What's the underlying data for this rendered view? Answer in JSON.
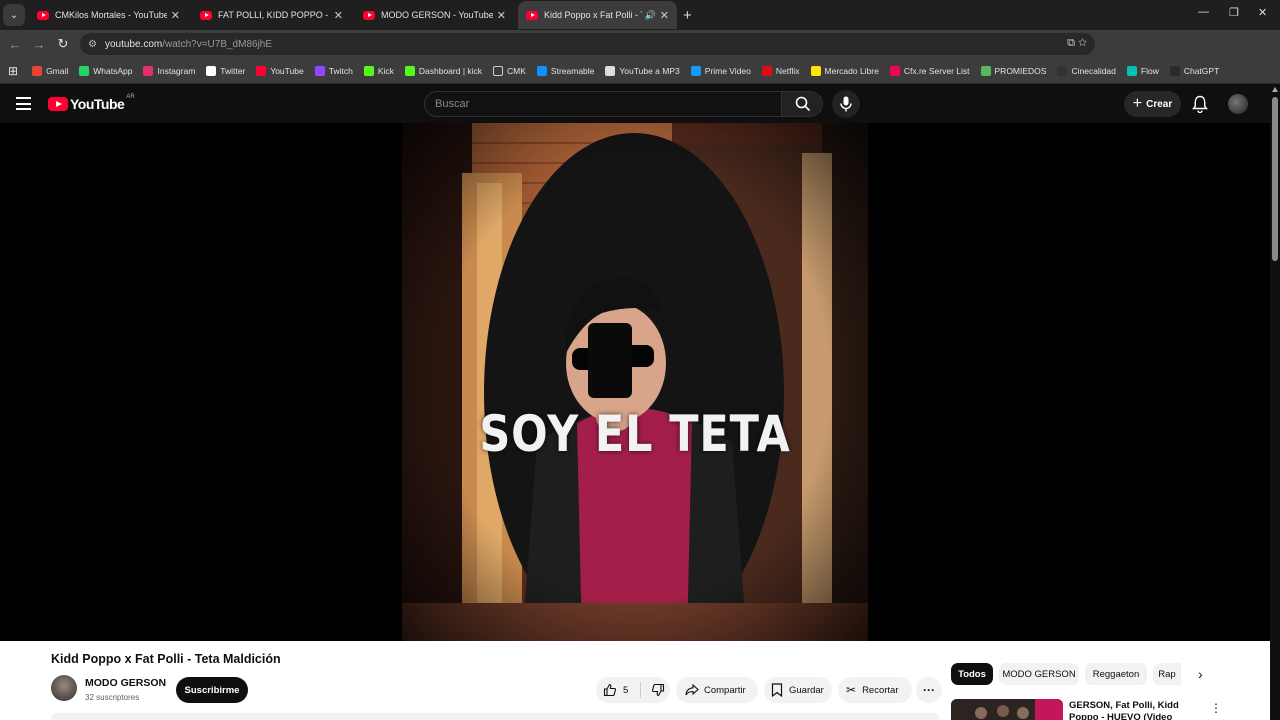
{
  "browser": {
    "tabs": [
      {
        "title": "CMKilos Mortales - YouTube",
        "active": false
      },
      {
        "title": "FAT POLLI, KIDD POPPO - PEPI",
        "active": false
      },
      {
        "title": "MODO GERSON - YouTube",
        "active": false
      },
      {
        "title": "Kidd Poppo x Fat Polli - Teta",
        "active": true,
        "audio": true
      }
    ],
    "url_host": "youtube.com",
    "url_path": "/watch?v=U7B_dM86jhE",
    "bookmarks": [
      {
        "label": "Gmail",
        "icon": "gmail-icon",
        "color": "#ea4335"
      },
      {
        "label": "WhatsApp",
        "icon": "whatsapp-icon",
        "color": "#25d366"
      },
      {
        "label": "Instagram",
        "icon": "instagram-icon",
        "color": "#e1306c"
      },
      {
        "label": "Twitter",
        "icon": "x-icon",
        "color": "#ffffff"
      },
      {
        "label": "YouTube",
        "icon": "youtube-icon",
        "color": "#ff0033"
      },
      {
        "label": "Twitch",
        "icon": "twitch-icon",
        "color": "#9146ff"
      },
      {
        "label": "Kick",
        "icon": "kick-icon",
        "color": "#53fc18"
      },
      {
        "label": "Dashboard | kick",
        "icon": "kick-icon",
        "color": "#53fc18"
      },
      {
        "label": "CMK",
        "icon": "folder-icon",
        "color": "#3c3c3c"
      },
      {
        "label": "Streamable",
        "icon": "streamable-icon",
        "color": "#0f90fa"
      },
      {
        "label": "YouTube a MP3",
        "icon": "mp3-icon",
        "color": "#dddddd"
      },
      {
        "label": "Prime Video",
        "icon": "prime-video-icon",
        "color": "#1399ff"
      },
      {
        "label": "Netflix",
        "icon": "netflix-icon",
        "color": "#e50914"
      },
      {
        "label": "Mercado Libre",
        "icon": "mercadolibre-icon",
        "color": "#ffe600"
      },
      {
        "label": "Cfx.re Server List",
        "icon": "cfx-icon",
        "color": "#f40552"
      },
      {
        "label": "PROMIEDOS",
        "icon": "promiedos-icon",
        "color": "#5cb85c"
      },
      {
        "label": "Cinecalidad",
        "icon": "cinecalidad-icon",
        "color": "#333333"
      },
      {
        "label": "Flow",
        "icon": "flow-icon",
        "color": "#00c4b3"
      },
      {
        "label": "ChatGPT",
        "icon": "chatgpt-icon",
        "color": "#2b2b2b"
      }
    ]
  },
  "youtube": {
    "logo_text": "YouTube",
    "country": "AR",
    "search_placeholder": "Buscar",
    "create_label": "Crear"
  },
  "video": {
    "overlay_text": "SOY EL TETA",
    "title": "Kidd Poppo x Fat Polli - Teta Maldición",
    "channel": "MODO GERSON",
    "subscribers": "32 suscriptores",
    "subscribe_label": "Suscribirme",
    "likes": "5",
    "share_label": "Compartir",
    "save_label": "Guardar",
    "clip_label": "Recortar"
  },
  "sidebar": {
    "chips": [
      "Todos",
      "MODO GERSON",
      "Reggaeton",
      "Rap"
    ],
    "recommendation_title": "GERSON, Fat Polli, Kidd Poppo - HUEVO (Video Oficial)"
  },
  "colors": {
    "brand_red": "#ff0033",
    "dark_bg": "#0f0f0f"
  }
}
